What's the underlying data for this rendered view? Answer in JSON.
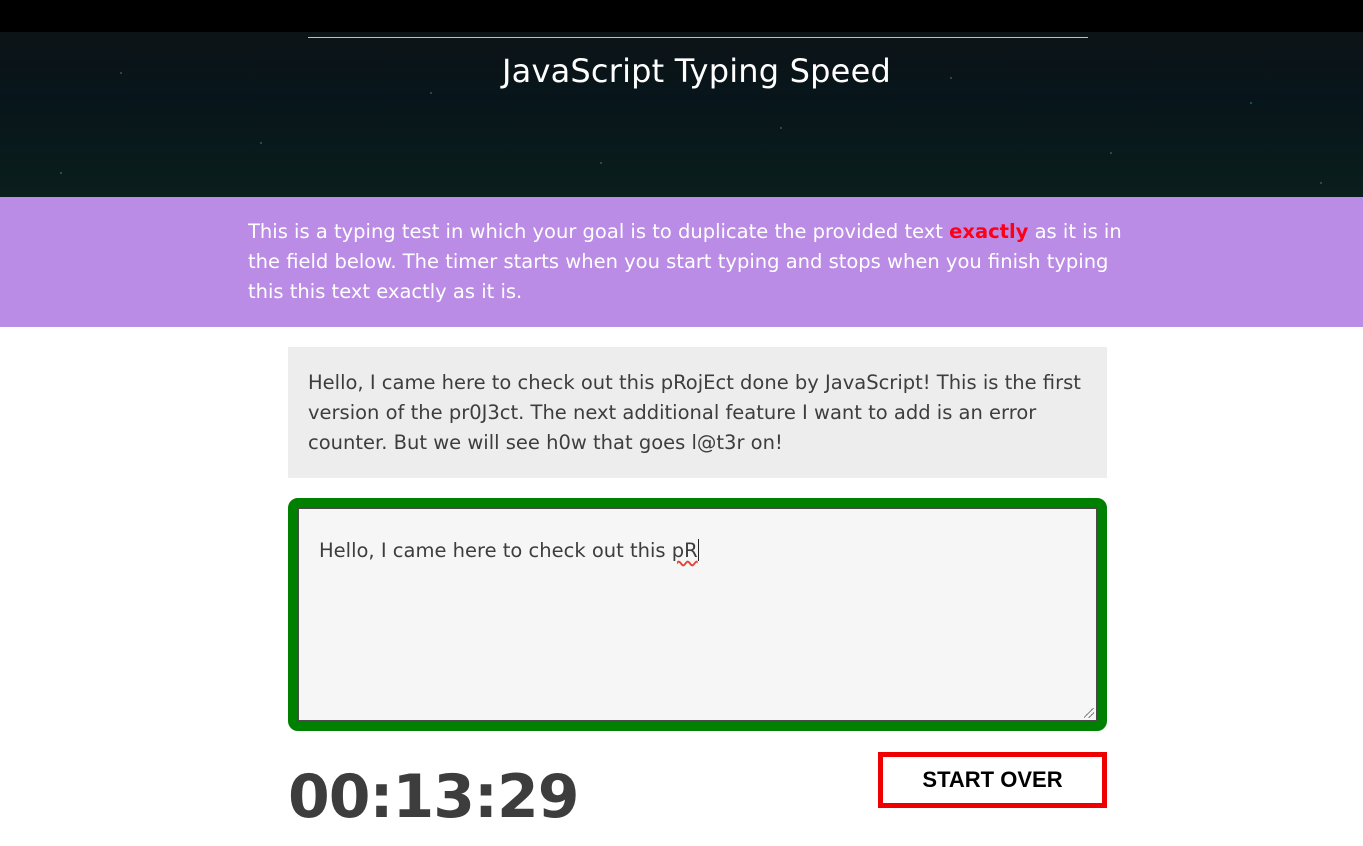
{
  "header": {
    "title": "JavaScript Typing Speed"
  },
  "intro": {
    "text_before": "This is a typing test in which your goal is to duplicate the provided text ",
    "emphasis": "exactly",
    "text_after": " as it is in the field below. The timer starts when you start typing and stops when you finish typing this this text exactly as it is."
  },
  "origin_text": "Hello, I came here to check out this pRojEct done by JavaScript! This is the first version of the pr0J3ct. The next additional feature I want to add is an error counter. But we will see h0w that goes l@t3r on!",
  "typing": {
    "typed_prefix": "Hello, I came here to check out this ",
    "typed_flagged": "pR",
    "border_color": "#008000"
  },
  "timer": {
    "value": "00:13:29"
  },
  "controls": {
    "reset_label": "START OVER"
  },
  "colors": {
    "intro_background": "#ba8ce6",
    "emphasis": "#ff0019",
    "reset_border": "#ee0000"
  }
}
